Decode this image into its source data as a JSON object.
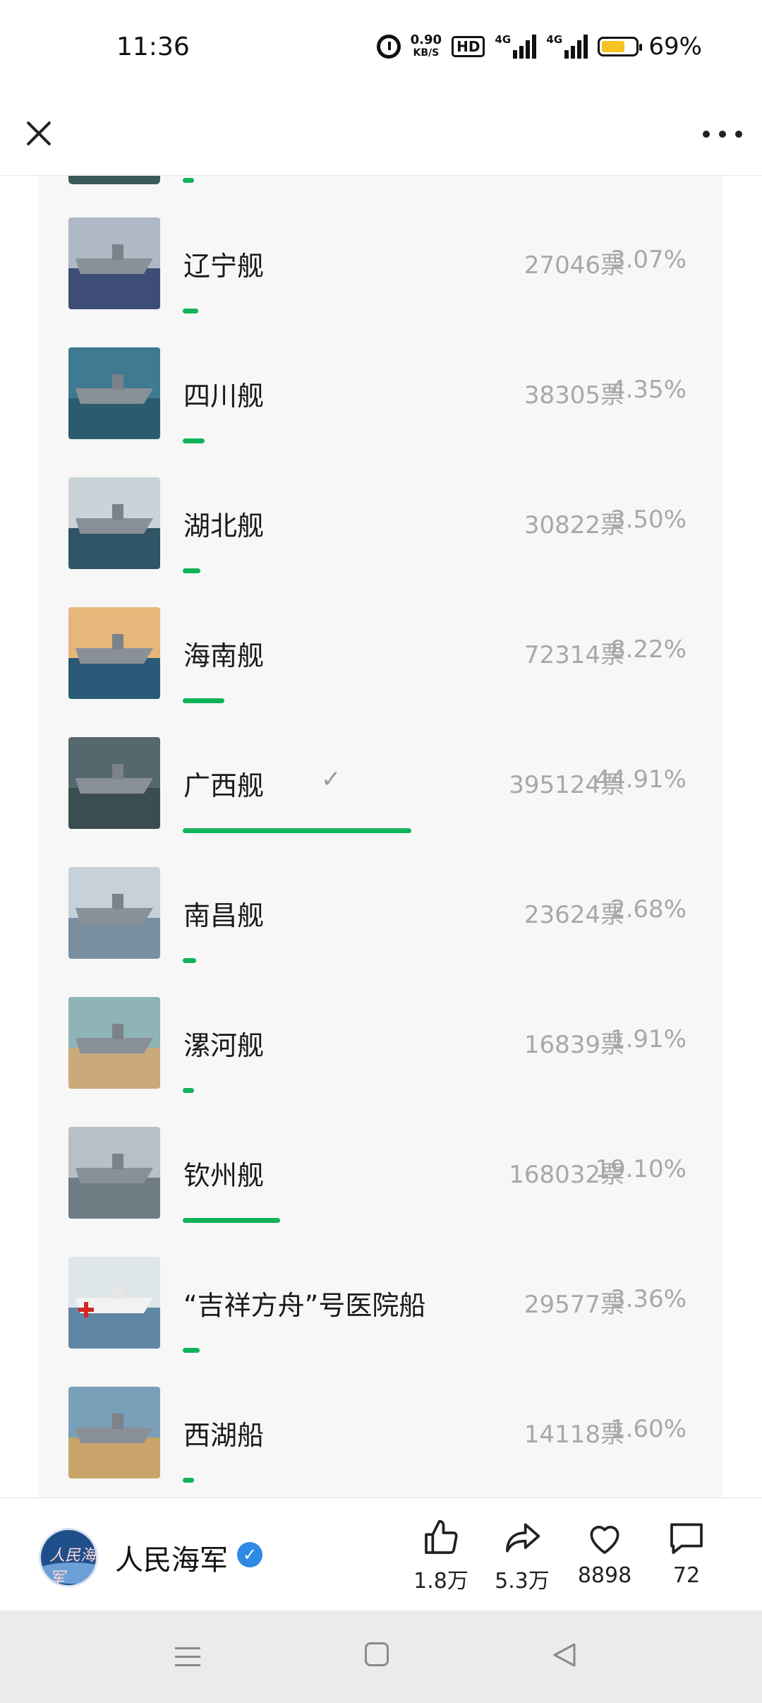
{
  "status_bar": {
    "time": "11:36",
    "net_speed_value": "0.90",
    "net_speed_unit": "KB/S",
    "hd_label": "HD",
    "sim1_label": "4G",
    "sim2_label": "4G",
    "battery_percent": "69%",
    "battery_level": 0.69
  },
  "poll": {
    "accent_color": "#11b35a",
    "partial_top_bar_fraction": 0.02,
    "options": [
      {
        "name": "辽宁舰",
        "votes": "27046票",
        "percent": "3.07%",
        "fraction": 0.0307,
        "selected": false,
        "thumb": "carrier",
        "sky": "#aeb8c7",
        "sea": "#3d4d75"
      },
      {
        "name": "四川舰",
        "votes": "38305票",
        "percent": "4.35%",
        "fraction": 0.0435,
        "selected": false,
        "thumb": "carrier",
        "sky": "#3f7a92",
        "sea": "#2b5b6e"
      },
      {
        "name": "湖北舰",
        "votes": "30822票",
        "percent": "3.50%",
        "fraction": 0.035,
        "selected": false,
        "thumb": "carrier",
        "sky": "#c9d3d8",
        "sea": "#2f5566"
      },
      {
        "name": "海南舰",
        "votes": "72314票",
        "percent": "8.22%",
        "fraction": 0.0822,
        "selected": false,
        "thumb": "amphibious",
        "sky": "#e7b67a",
        "sea": "#2b5a78"
      },
      {
        "name": "广西舰",
        "votes": "395124票",
        "percent": "44.91%",
        "fraction": 0.4491,
        "selected": true,
        "thumb": "amphibious",
        "sky": "#55686e",
        "sea": "#3a4e52"
      },
      {
        "name": "南昌舰",
        "votes": "23624票",
        "percent": "2.68%",
        "fraction": 0.0268,
        "selected": false,
        "thumb": "destroyer",
        "sky": "#c6d1d9",
        "sea": "#7a8fa0"
      },
      {
        "name": "漯河舰",
        "votes": "16839票",
        "percent": "1.91%",
        "fraction": 0.0191,
        "selected": false,
        "thumb": "frigate",
        "sky": "#8fb4b7",
        "sea": "#caa97a"
      },
      {
        "name": "钦州舰",
        "votes": "168032票",
        "percent": "19.10%",
        "fraction": 0.191,
        "selected": false,
        "thumb": "frigate",
        "sky": "#b7c0c6",
        "sea": "#6f7c84"
      },
      {
        "name": "“吉祥方舟”号医院船",
        "votes": "29577票",
        "percent": "3.36%",
        "fraction": 0.0336,
        "selected": false,
        "thumb": "hospital",
        "sky": "#dfe6ea",
        "sea": "#5f86a5"
      },
      {
        "name": "西湖船",
        "votes": "14118票",
        "percent": "1.60%",
        "fraction": 0.016,
        "selected": false,
        "thumb": "supply",
        "sky": "#7a9fb8",
        "sea": "#c8a46a"
      }
    ],
    "check_glyph": "✓"
  },
  "action_bar": {
    "account_name": "人民海军",
    "avatar_text": "人民海军",
    "verified_glyph": "✓",
    "like_count": "1.8万",
    "share_count": "5.3万",
    "favorite_count": "8898",
    "comment_count": "72"
  }
}
